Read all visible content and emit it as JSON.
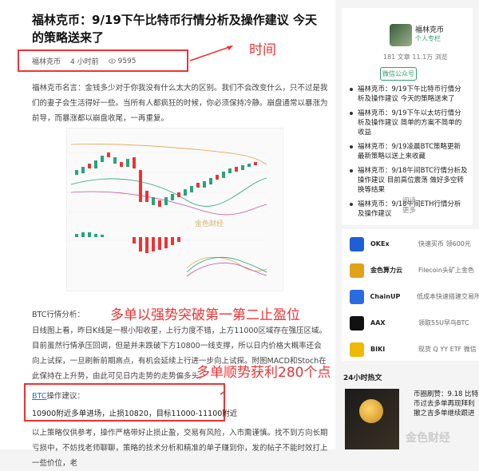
{
  "article": {
    "title": "福林克币：9/19下午比特币行情分析及操作建议 今天的策略送来了",
    "author": "福林克币",
    "time": "4 小时前",
    "views": "9595",
    "intro": "福林克币名言：金钱多少对于你我没有什么太大的区别。我们不会改变什么，只不过是我们的妻子会生活得好一些。当所有人都疯狂的时候，你必须保持冷静。崩盘通常以暴涨为前导，而暴涨都以崩盘收尾，一再重复。",
    "chart_top_label": "",
    "chart_macd_label": "",
    "chart_x_labels": "",
    "chart_watermark": "金色财经",
    "section_label": "BTC行情分析：",
    "analysis": "日线图上看，昨日K线是一根小阳收星，上行力度不错，上方11000区域存在强压区域。目前虽然行情承压回调，但是并未跌破下方10800一线支撑，所以日内价格大概率还会向上试探，一旦刷新前期高点，有机会延续上行进一步向上试探。附图MACD和Stoch在此保持在上升势，由此可见日内走势的走势偏多头。",
    "op_prefix": "BTC",
    "op_suffix": "操作建议：",
    "op_line": "10900附近多单进场，止损10820，目标11000-11100附近",
    "footer": "以上策略仅供参考，操作严格带好止损止盈，交易有风险，入市需谨慎。找不到方向长期亏损中，不妨找老师聊聊，策略的技术分析和精准的单子赚到你，发的帖子不能时效打上一些价位，老"
  },
  "annotations": {
    "time": "时间",
    "strategy": "多单以强势突破第一第二止盈位",
    "profit": "多单顺势获利280个点"
  },
  "profile": {
    "name": "福林克币",
    "badge": "个人专栏",
    "stats": "181 文章   11.1万 浏览",
    "button": "微信公众号",
    "items": [
      "福林克币：9/19下午比特币行情分析及操作建议 今天的策略送来了",
      "福林克币：9/19下午以太坊行情分析及操作建议 简单的方案不简单的收益",
      "福林克币：9/19凌晨BTC策略更新 最新策略以送上来收藏",
      "福林克币：9/18午间BTC行情分析及操作建议 目前高位震荡 做好多空转换等结果",
      "福林克币：9/18午间ETH行情分析及操作建议"
    ],
    "more": "阅读更多"
  },
  "exchanges": [
    {
      "name": "OKEx",
      "desc": "快速买币 领600元",
      "color": "#1e5fd6"
    },
    {
      "name": "金色算力云",
      "desc": "Filecoin头矿上金色",
      "color": "#e0a21a"
    },
    {
      "name": "ChainUP",
      "desc": "低成本快速搭建交易所",
      "color": "#2a6be0"
    },
    {
      "name": "AAX",
      "desc": "领取55U早鸟BTC",
      "color": "#111111"
    },
    {
      "name": "BIKI",
      "desc": "现货 Q YY ETF 微信",
      "color": "#f0b800"
    }
  ],
  "hot": {
    "title": "24小时热文",
    "item": "币圈刷赞：9.18 比特币过去多单再现拜利 撤之吉多单继续跟进",
    "watermark": "金色财经"
  }
}
